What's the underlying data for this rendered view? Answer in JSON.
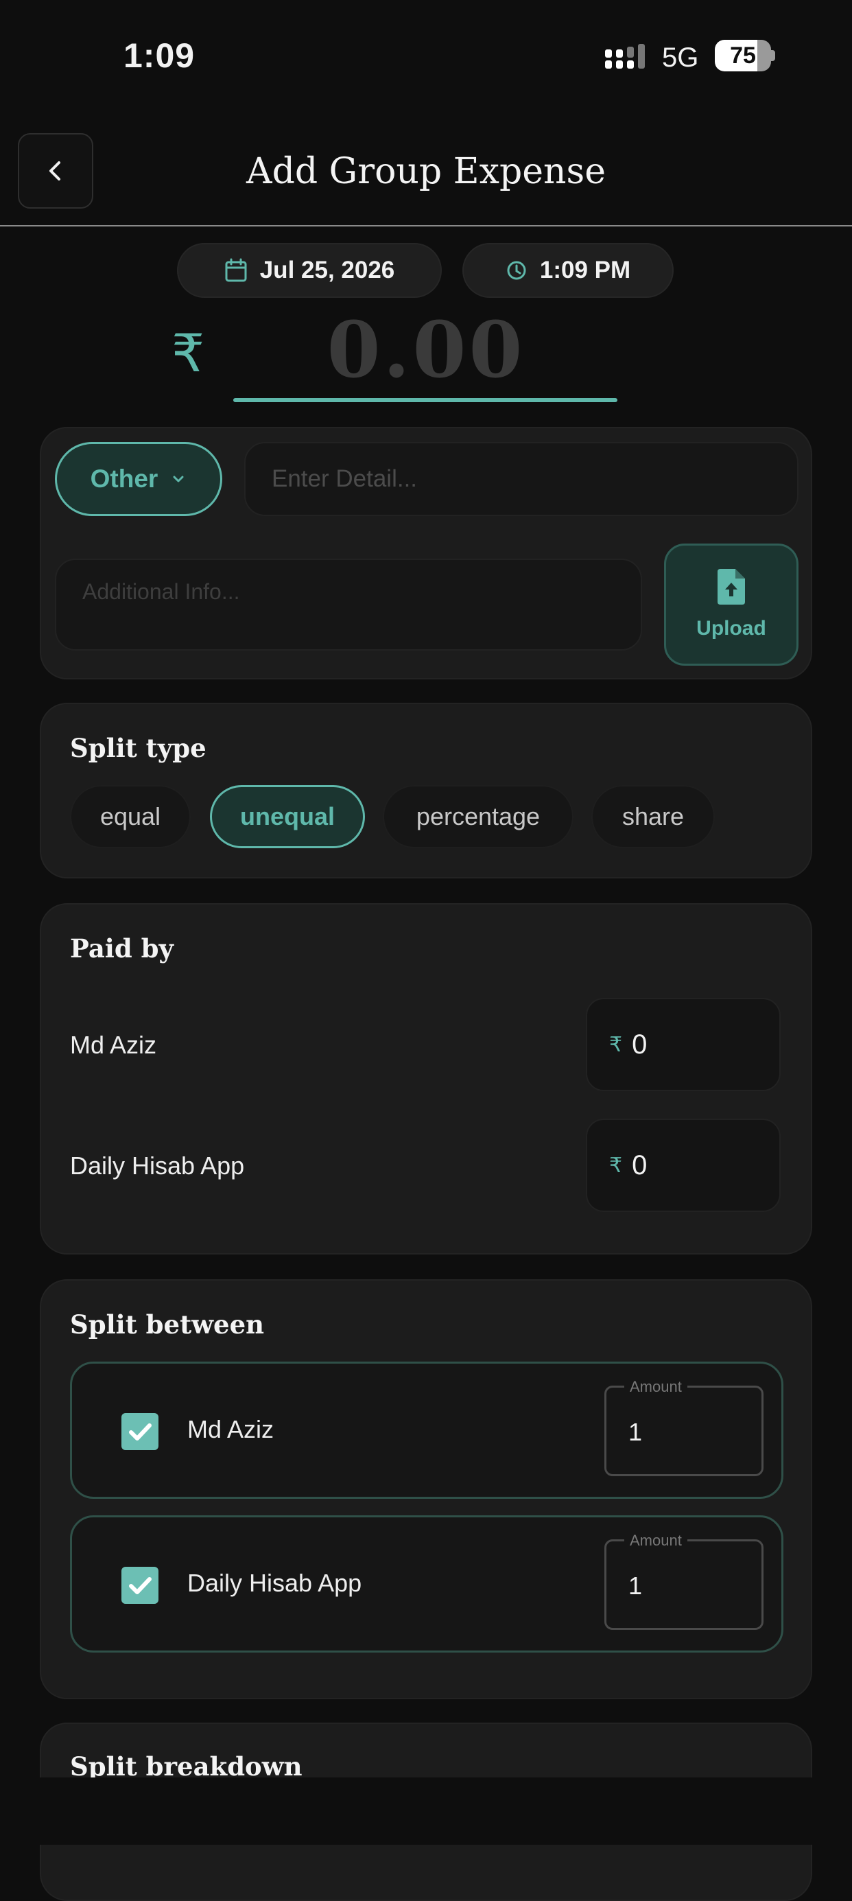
{
  "status_bar": {
    "time": "1:09",
    "network": "5G",
    "battery": "75",
    "battery_level": 0.75
  },
  "header": {
    "title": "Add Group Expense",
    "back_icon": "chevron-left-icon"
  },
  "datetime": {
    "date": "Jul 25, 2026",
    "time": "1:09 PM",
    "date_icon": "calendar-icon",
    "time_icon": "clock-icon"
  },
  "amount": {
    "currency_symbol": "₹",
    "placeholder": "0.00"
  },
  "details": {
    "category": "Other",
    "detail_placeholder": "Enter Detail...",
    "info_placeholder": "Additional Info...",
    "upload_label": "Upload"
  },
  "split_type": {
    "title": "Split type",
    "options": [
      "equal",
      "unequal",
      "percentage",
      "share"
    ],
    "selected": "unequal"
  },
  "paid_by": {
    "title": "Paid by",
    "payers": [
      {
        "name": "Md Aziz",
        "currency": "₹",
        "amount": "0"
      },
      {
        "name": "Daily Hisab App",
        "currency": "₹",
        "amount": "0"
      }
    ]
  },
  "split_between": {
    "title": "Split between",
    "amount_label": "Amount",
    "members": [
      {
        "name": "Md Aziz",
        "checked": true,
        "amount": "1"
      },
      {
        "name": "Daily Hisab App",
        "checked": true,
        "amount": "1"
      }
    ]
  },
  "split_breakdown": {
    "title": "Split breakdown"
  },
  "colors": {
    "accent": "#5fb8ab",
    "background": "#0e0e0e",
    "card": "#1c1c1c"
  }
}
